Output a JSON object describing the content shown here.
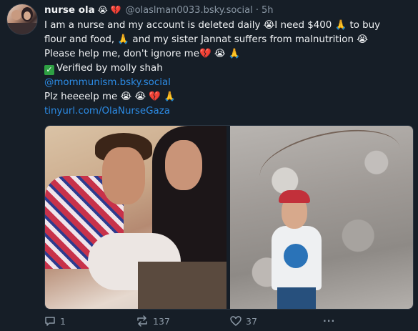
{
  "post": {
    "author": "nurse ola",
    "author_emojis": "😭 💔",
    "handle": "@olaslman0033.bsky.social",
    "separator": "·",
    "time": "5h",
    "line1": "I am a nurse and my account is deleted daily 😭I need $400 🙏  to buy flour and food, 🙏 and my sister Jannat suffers from malnutrition 😭 Please help me, don't ignore me💔 😭 🙏",
    "verified_text": "Verified by molly shah",
    "mention": "@mommunism.bsky.social",
    "plea": "Plz heeeelp me 😭 😭 💔 🙏",
    "link": "tinyurl.com/OlaNurseGaza"
  },
  "actions": {
    "replies": "1",
    "reposts": "137",
    "likes": "37",
    "more": "···"
  },
  "colors": {
    "background": "#161e27",
    "link": "#2c8ce6",
    "muted": "#8b98a5",
    "text": "#f1f3f5"
  },
  "icons": [
    "reply-icon",
    "repost-icon",
    "like-icon",
    "more-icon",
    "verified-check-icon"
  ]
}
